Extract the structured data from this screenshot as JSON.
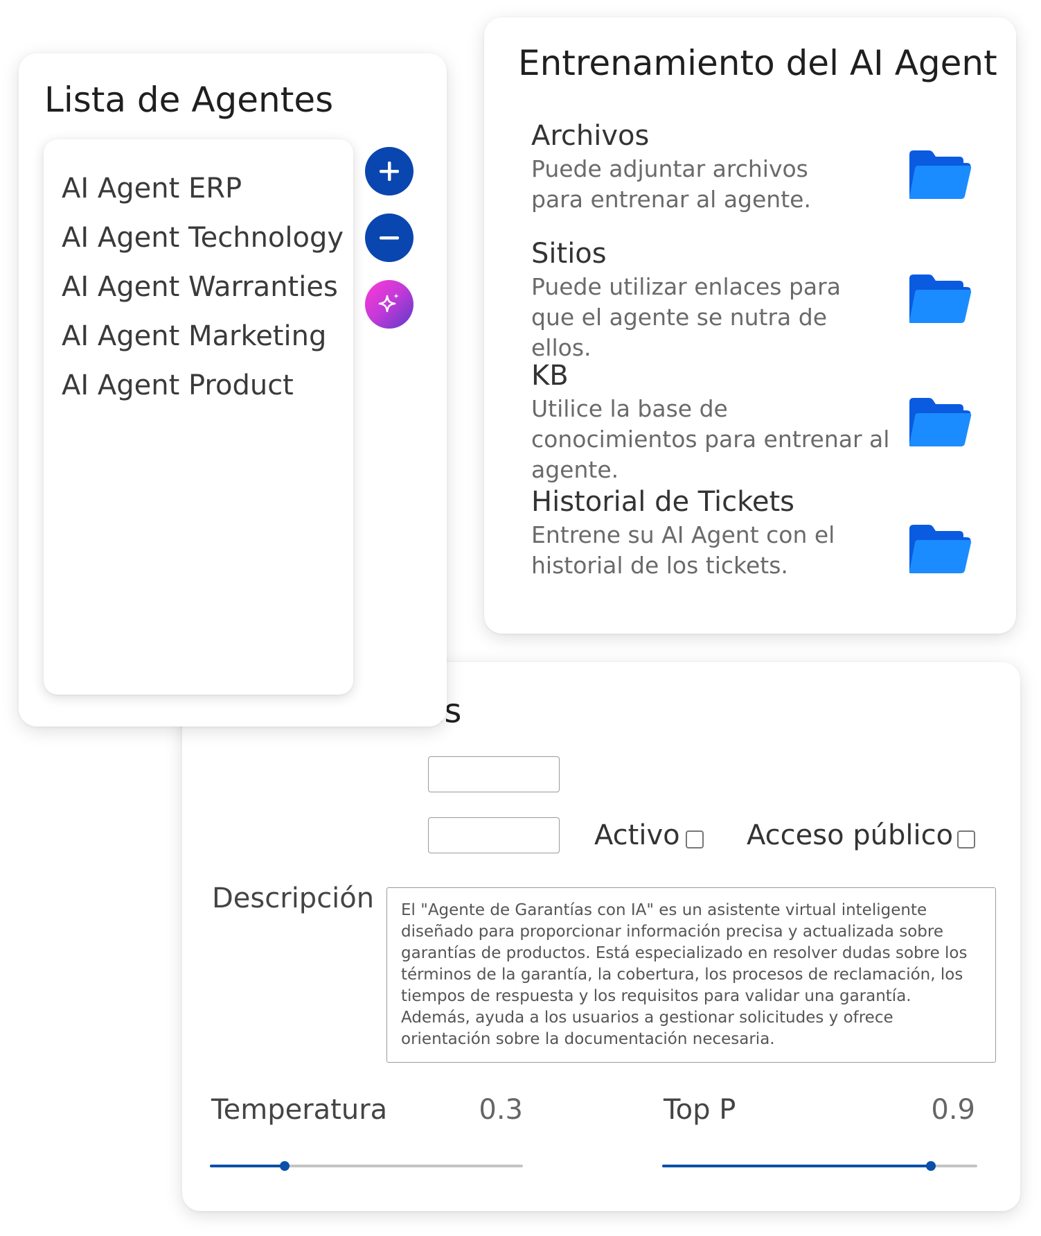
{
  "agents_panel": {
    "title": "Lista de Agentes",
    "agents": [
      {
        "label": "AI Agent ERP"
      },
      {
        "label": "AI Agent Technology"
      },
      {
        "label": "AI Agent Warranties"
      },
      {
        "label": "AI Agent Marketing"
      },
      {
        "label": "AI Agent Product"
      }
    ],
    "actions": {
      "add_icon": "plus-icon",
      "remove_icon": "minus-icon",
      "ai_icon": "sparkle-icon"
    }
  },
  "training_panel": {
    "title": "Entrenamiento del AI Agent",
    "sections": [
      {
        "heading": "Archivos",
        "description": "Puede adjuntar archivos para entrenar al agente.",
        "icon": "folder-icon"
      },
      {
        "heading": "Sitios",
        "description": "Puede utilizar enlaces para que el agente se nutra de ellos.",
        "icon": "folder-icon"
      },
      {
        "heading": "KB",
        "description": "Utilice la base de conocimientos para entrenar al agente.",
        "icon": "folder-icon"
      },
      {
        "heading": "Historial de Tickets",
        "description": "Entrene su AI Agent con el historial de los tickets.",
        "icon": "folder-icon"
      }
    ]
  },
  "config_panel": {
    "title_visible_fragment": "tes",
    "name_input_value": "",
    "model_input_value": "",
    "activo_label": "Activo",
    "activo_checked": false,
    "publico_label": "Acceso público",
    "publico_checked": false,
    "description_label": "Descripción",
    "description_value": "El \"Agente de Garantías con IA\" es un asistente virtual inteligente diseñado para proporcionar información precisa y actualizada sobre garantías de productos. Está especializado en resolver dudas sobre los términos de la garantía, la cobertura, los procesos de reclamación, los tiempos de respuesta y los requisitos para validar una garantía. Además, ayuda a los usuarios a gestionar solicitudes y ofrece orientación sobre la documentación necesaria.",
    "temperature": {
      "label": "Temperatura",
      "value": "0.3",
      "fraction": 0.24
    },
    "top_p": {
      "label": "Top P",
      "value": "0.9",
      "fraction": 0.853
    }
  },
  "colors": {
    "primary_blue": "#0a46b0",
    "slider_blue": "#0a4fa8",
    "folder_blue": "#1a8cff",
    "folder_blue_dark": "#0a5be0",
    "ai_gradient_start": "#ff3ad6",
    "ai_gradient_end": "#5a3ac8"
  }
}
